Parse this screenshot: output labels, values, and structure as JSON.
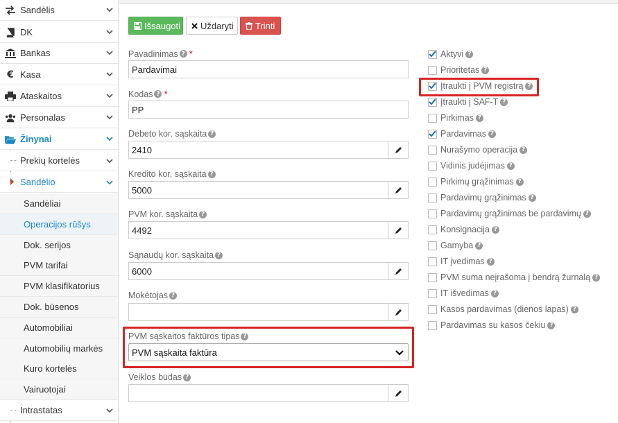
{
  "sidebar": {
    "items": [
      {
        "label": "Sandėlis",
        "icon": "exchange-icon"
      },
      {
        "label": "DK",
        "icon": "book-icon"
      },
      {
        "label": "Bankas",
        "icon": "bank-icon"
      },
      {
        "label": "Kasa",
        "icon": "euro-icon"
      },
      {
        "label": "Ataskaitos",
        "icon": "print-icon"
      },
      {
        "label": "Personalas",
        "icon": "users-icon"
      },
      {
        "label": "Žinynai",
        "icon": "folder-open-icon"
      }
    ],
    "subitems": [
      {
        "label": "Prekių kortelės"
      },
      {
        "label": "Sandėlio"
      }
    ],
    "subsubitems": [
      {
        "label": "Sandėliai"
      },
      {
        "label": "Operacijos rūšys"
      },
      {
        "label": "Dok. serijos"
      },
      {
        "label": "PVM tarifai"
      },
      {
        "label": "PVM klasifikatorius"
      },
      {
        "label": "Dok. būsenos"
      },
      {
        "label": "Automobiliai"
      },
      {
        "label": "Automobilių markės"
      },
      {
        "label": "Kuro kortelės"
      },
      {
        "label": "Vairuotojai"
      }
    ],
    "tail": {
      "label": "Intrastatas"
    }
  },
  "toolbar": {
    "save_label": "Išsaugoti",
    "close_label": "Uždaryti",
    "delete_label": "Trinti"
  },
  "form": {
    "name_label": "Pavadinimas",
    "name_value": "Pardavimai",
    "code_label": "Kodas",
    "code_value": "PP",
    "debit_label": "Debeto kor. sąskaita",
    "debit_value": "2410",
    "credit_label": "Kredito kor. sąskaita",
    "credit_value": "5000",
    "vat_label": "PVM kor. sąskaita",
    "vat_value": "4492",
    "cost_label": "Sąnaudų kor. sąskaita",
    "cost_value": "6000",
    "payer_label": "Mokėtojas",
    "payer_value": "",
    "invoice_type_label": "PVM sąskaitos faktūros tipas",
    "invoice_type_value": "PVM sąskaita faktūra",
    "activity_label": "Veiklos būdas",
    "activity_value": ""
  },
  "checkboxes": [
    {
      "label": "Aktyvi",
      "checked": true
    },
    {
      "label": "Prioritetas",
      "checked": false
    },
    {
      "label": "Įtraukti į PVM registrą",
      "checked": true
    },
    {
      "label": "Įtraukti į SAF-T",
      "checked": true
    },
    {
      "label": "Pirkimas",
      "checked": false
    },
    {
      "label": "Pardavimas",
      "checked": true
    },
    {
      "label": "Nurašymo operacija",
      "checked": false
    },
    {
      "label": "Vidinis judėjimas",
      "checked": false
    },
    {
      "label": "Pirkimų grąžinimas",
      "checked": false
    },
    {
      "label": "Pardavimų grąžinimas",
      "checked": false
    },
    {
      "label": "Pardavimų grąžinimas be pardavimų",
      "checked": false
    },
    {
      "label": "Konsignacija",
      "checked": false
    },
    {
      "label": "Gamyba",
      "checked": false
    },
    {
      "label": "IT įvedimas",
      "checked": false
    },
    {
      "label": "PVM suma neįrašoma į bendrą žurnalą",
      "checked": false
    },
    {
      "label": "IT išvedimas",
      "checked": false
    },
    {
      "label": "Kasos pardavimas (dienos lapas)",
      "checked": false
    },
    {
      "label": "Pardavimas su kasos čekiu",
      "checked": false
    }
  ],
  "colors": {
    "accent": "#1e88c7",
    "save": "#5cb85c",
    "delete": "#d9534f",
    "highlight": "#d92424",
    "checkmark": "#1e6fb8"
  }
}
